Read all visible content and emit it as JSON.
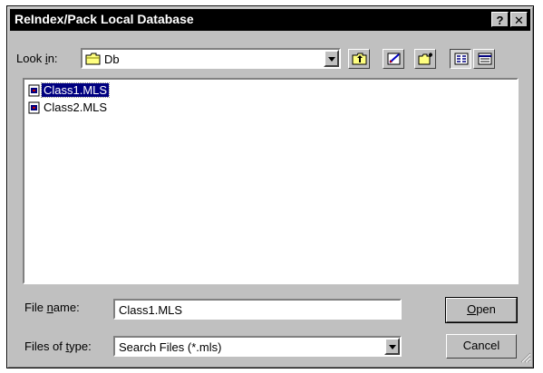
{
  "window": {
    "title": "ReIndex/Pack Local Database",
    "help_label": "?",
    "close_label": "✕"
  },
  "lookin": {
    "label_pre": "Look ",
    "label_u": "i",
    "label_post": "n:",
    "value": "Db"
  },
  "toolbar": [
    "up-one-level-icon",
    "desktop-icon",
    "new-folder-icon",
    "list-view-icon",
    "details-view-icon"
  ],
  "files": [
    {
      "name": "Class1.MLS",
      "selected": true
    },
    {
      "name": "Class2.MLS",
      "selected": false
    }
  ],
  "filename": {
    "label_pre": "File ",
    "label_u": "n",
    "label_post": "ame:",
    "value": "Class1.MLS"
  },
  "filetype": {
    "label_pre": "Files of ",
    "label_u": "t",
    "label_post": "ype:",
    "value": "Search Files (*.mls)"
  },
  "buttons": {
    "open_u": "O",
    "open_rest": "pen",
    "cancel": "Cancel"
  },
  "colors": {
    "titlebar": "#000000",
    "face": "#c0c0c0",
    "selection": "#000080"
  }
}
